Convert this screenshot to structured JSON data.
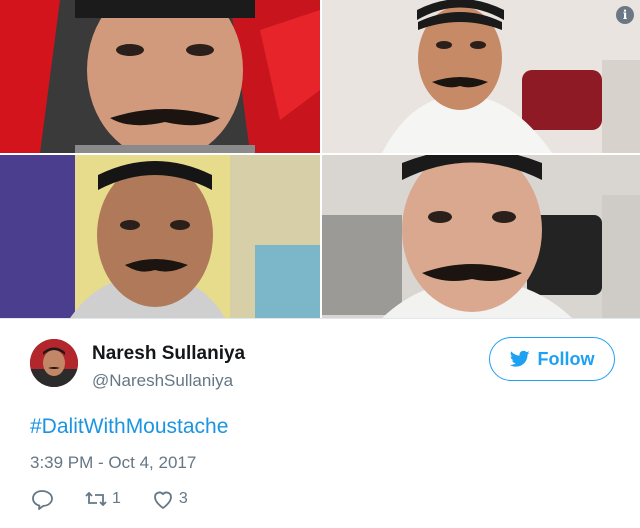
{
  "tweet": {
    "user_name": "Naresh Sullaniya",
    "user_handle": "@NareshSullaniya",
    "follow_label": "Follow",
    "hashtag": "#DalitWithMoustache",
    "timestamp": "3:39 PM - Oct 4, 2017",
    "retweet_count": "1",
    "like_count": "3"
  },
  "icons": {
    "info": "info-icon",
    "follow_bird": "twitter-bird-icon",
    "reply": "reply-icon",
    "retweet": "retweet-icon",
    "like": "heart-icon"
  },
  "colors": {
    "accent": "#1da1f2",
    "link": "#1b95e0",
    "secondary_text": "#657786",
    "primary_text": "#14171a"
  }
}
